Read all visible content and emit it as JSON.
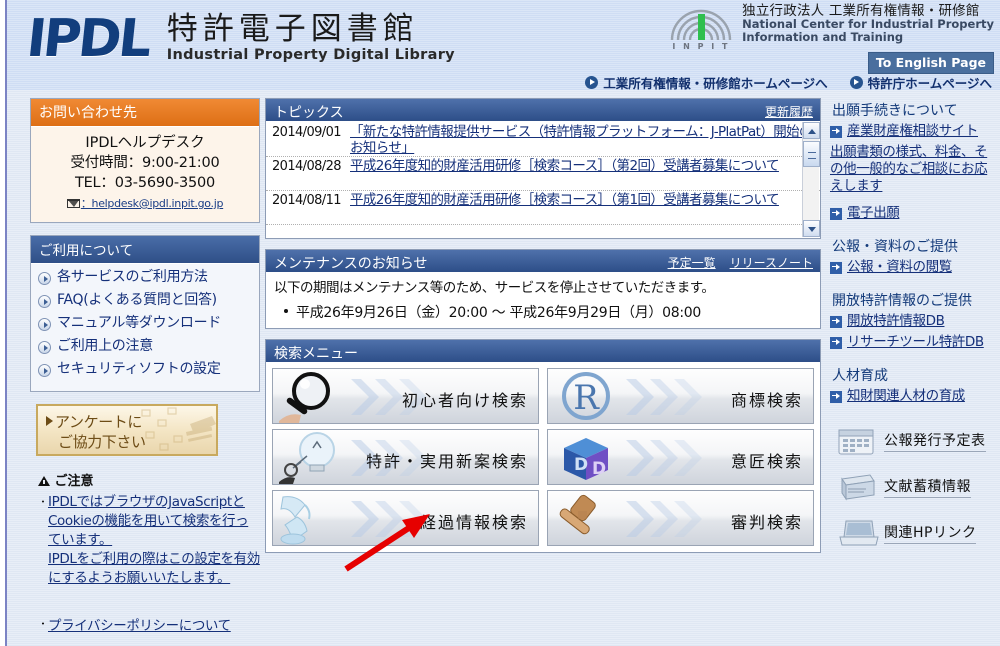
{
  "header": {
    "logo_mark": "IPDL",
    "jp_title": "特許電子図書館",
    "en_title": "Industrial Property Digital Library",
    "inpit_logo_label": "I N P I T",
    "inpit_jp": "独立行政法人 工業所有権情報・研修館",
    "inpit_en_line1": "National Center for Industrial Property",
    "inpit_en_line2": "Information and Training",
    "english_button": "To English Page",
    "links": [
      {
        "label": "工業所有権情報・研修館ホームページへ",
        "icon": "play-circle-icon"
      },
      {
        "label": "特許庁ホームページへ",
        "icon": "play-circle-icon"
      }
    ]
  },
  "left": {
    "contact": {
      "title": "お問い合わせ先",
      "line1": "IPDLヘルプデスク",
      "line2": "受付時間：9:00-21:00",
      "line3": "TEL：03-5690-3500",
      "email": "：helpdesk@ipdl.inpit.go.jp",
      "email_icon": "envelope-icon"
    },
    "usage": {
      "title": "ご利用について",
      "items": [
        "各サービスのご利用方法",
        "FAQ(よくある質問と回答)",
        "マニュアル等ダウンロード",
        "ご利用上の注意",
        "セキュリティソフトの設定"
      ]
    },
    "questionnaire": {
      "line1": "アンケートに",
      "line2": "ご協力下さい"
    },
    "caution": {
      "title": "ご注意",
      "warn_icon": "warning-triangle-icon",
      "body1": "IPDLではブラウザのJavaScriptとCookieの機能を用いて検索を行っています。",
      "body2": "IPDLをご利用の際はこの設定を有効にするようお願いいたします。",
      "privacy": "プライバシーポリシーについて"
    }
  },
  "topics": {
    "title": "トピックス",
    "history_link": "更新履歴",
    "scrollbar": {
      "up_icon": "chevron-up-icon",
      "down_icon": "chevron-down-icon"
    },
    "rows": [
      {
        "date": "2014/09/01",
        "text": "「新たな特許情報提供サービス（特許情報プラットフォーム：J-PlatPat）開始のお知らせ」"
      },
      {
        "date": "2014/08/28",
        "text": "平成26年度知的財産活用研修［検索コース］（第2回）受講者募集について"
      },
      {
        "date": "2014/08/11",
        "text": "平成26年度知的財産活用研修［検索コース］（第1回）受講者募集について"
      }
    ]
  },
  "maintenance": {
    "title": "メンテナンスのお知らせ",
    "links": [
      "予定一覧",
      "リリースノート"
    ],
    "line1": "以下の期間はメンテナンス等のため、サービスを停止させていただきます。",
    "line2": "平成26年9月26日（金）20:00 ～ 平成26年9月29日（月）08:00"
  },
  "search_menu": {
    "title": "検索メニュー",
    "buttons": [
      {
        "label": "初心者向け検索",
        "icon": "magnifier-icon"
      },
      {
        "label": "商標検索",
        "icon": "registered-r-icon"
      },
      {
        "label": "特許・実用新案検索",
        "icon": "lightbulb-icon"
      },
      {
        "label": "意匠検索",
        "icon": "design-cube-icon"
      },
      {
        "label": "経過情報検索",
        "icon": "glass-pour-icon"
      },
      {
        "label": "審判検索",
        "icon": "gavel-icon"
      }
    ]
  },
  "right": {
    "sections": [
      {
        "heading": "出願手続きについて",
        "items": [
          {
            "label": "産業財産権相談サイト",
            "icon": "arrow-square-icon",
            "sub": "出願書類の様式、料金、その他一般的なご相談にお応えします"
          },
          {
            "label": "電子出願",
            "icon": "arrow-square-icon"
          }
        ]
      },
      {
        "heading": "公報・資料のご提供",
        "items": [
          {
            "label": "公報・資料の閲覧",
            "icon": "arrow-square-icon"
          }
        ]
      },
      {
        "heading": "開放特許情報のご提供",
        "items": [
          {
            "label": "開放特許情報DB",
            "icon": "arrow-square-icon"
          },
          {
            "label": "リサーチツール特許DB",
            "icon": "arrow-square-icon"
          }
        ]
      },
      {
        "heading": "人材育成",
        "items": [
          {
            "label": "知財関連人材の育成",
            "icon": "arrow-square-icon"
          }
        ]
      }
    ],
    "buttons": [
      {
        "label": "公報発行予定表",
        "icon": "calendar-icon"
      },
      {
        "label": "文献蓄積情報",
        "icon": "books-icon"
      },
      {
        "label": "関連HPリンク",
        "icon": "laptop-icon"
      }
    ]
  },
  "annotation": {
    "arrow": "red-arrow-annotation",
    "color": "#e60000"
  }
}
